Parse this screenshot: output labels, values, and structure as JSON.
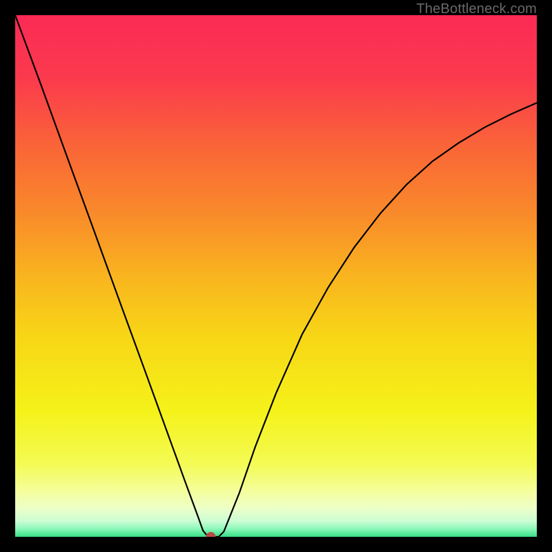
{
  "attribution": "TheBottleneck.com",
  "chart_data": {
    "type": "line",
    "title": "",
    "xlabel": "",
    "ylabel": "",
    "xlim": [
      0,
      1
    ],
    "ylim": [
      0,
      1
    ],
    "x": [
      0.0,
      0.05,
      0.1,
      0.15,
      0.2,
      0.25,
      0.3,
      0.325,
      0.35,
      0.36,
      0.37,
      0.38,
      0.39,
      0.4,
      0.43,
      0.46,
      0.5,
      0.55,
      0.6,
      0.65,
      0.7,
      0.75,
      0.8,
      0.85,
      0.9,
      0.95,
      1.0
    ],
    "values": [
      1.0,
      0.865,
      0.727,
      0.59,
      0.452,
      0.315,
      0.177,
      0.108,
      0.04,
      0.012,
      0.0,
      0.0,
      0.0,
      0.01,
      0.085,
      0.172,
      0.275,
      0.388,
      0.478,
      0.555,
      0.62,
      0.675,
      0.72,
      0.755,
      0.785,
      0.81,
      0.832
    ],
    "minimum_marker": {
      "x": 0.375,
      "y": 0.0,
      "color": "#b94a48",
      "radius": 7
    },
    "gradient_stops": [
      {
        "offset": 0.0,
        "color": "#fb2a55"
      },
      {
        "offset": 0.12,
        "color": "#fb3a4d"
      },
      {
        "offset": 0.25,
        "color": "#fa6438"
      },
      {
        "offset": 0.38,
        "color": "#f98a2a"
      },
      {
        "offset": 0.5,
        "color": "#f9b41f"
      },
      {
        "offset": 0.62,
        "color": "#f7d716"
      },
      {
        "offset": 0.76,
        "color": "#f5f21a"
      },
      {
        "offset": 0.86,
        "color": "#f4fb54"
      },
      {
        "offset": 0.915,
        "color": "#f5fea0"
      },
      {
        "offset": 0.945,
        "color": "#ecffc7"
      },
      {
        "offset": 0.97,
        "color": "#ccfdd4"
      },
      {
        "offset": 0.985,
        "color": "#89f8b8"
      },
      {
        "offset": 1.0,
        "color": "#37dd87"
      }
    ],
    "curve_style": {
      "stroke": "#000000",
      "width": 2.2
    }
  }
}
